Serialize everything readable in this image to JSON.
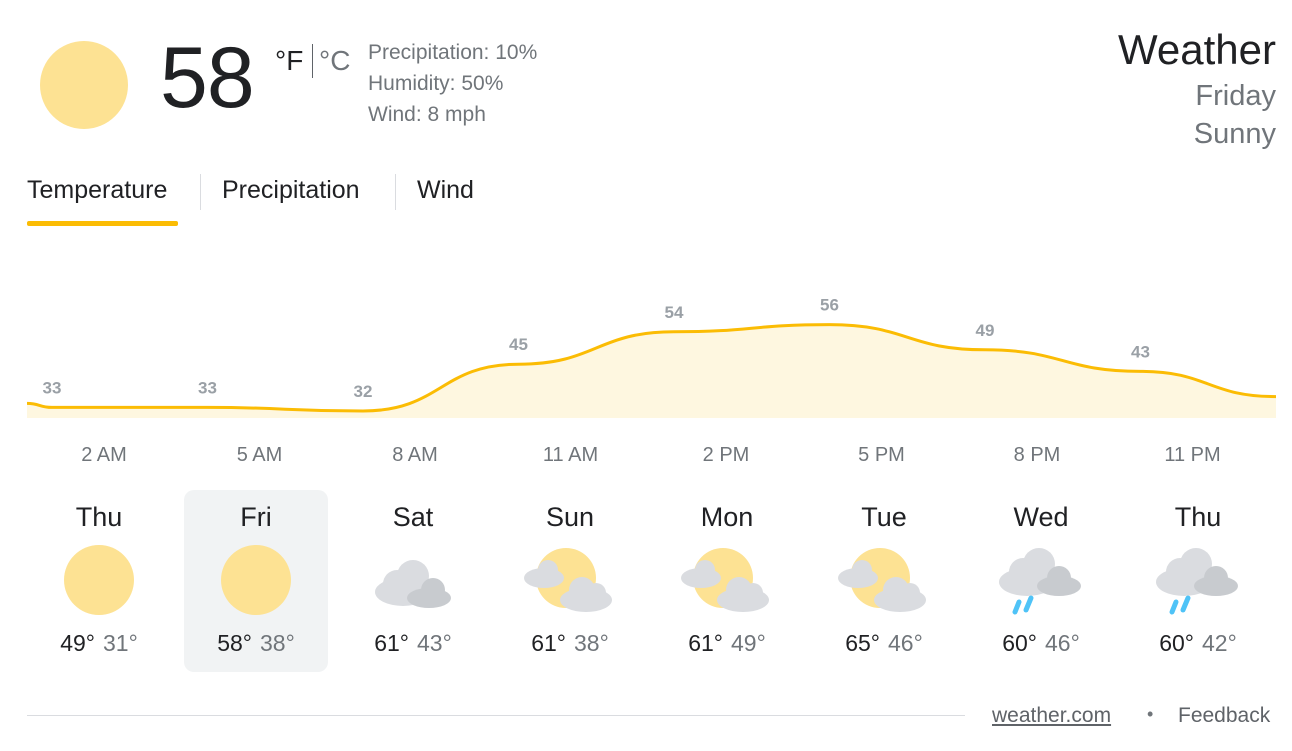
{
  "current": {
    "temperature": "58",
    "unit_f": "°F",
    "unit_c": "°C",
    "precipitation": "Precipitation: 10%",
    "humidity": "Humidity: 50%",
    "wind": "Wind: 8 mph",
    "icon": "sun-icon"
  },
  "header": {
    "title": "Weather",
    "day": "Friday",
    "condition": "Sunny"
  },
  "tabs": [
    "Temperature",
    "Precipitation",
    "Wind"
  ],
  "selected_tab": "Temperature",
  "chart_data": {
    "type": "area",
    "x": [
      "2 AM",
      "5 AM",
      "8 AM",
      "11 AM",
      "2 PM",
      "5 PM",
      "8 PM",
      "11 PM"
    ],
    "values": [
      33,
      33,
      32,
      45,
      54,
      56,
      49,
      43
    ],
    "color": "#fbbc04",
    "fill": "#fef7e0"
  },
  "days": [
    {
      "name": "Thu",
      "icon": "sunny-icon",
      "high": "49°",
      "low": "31°"
    },
    {
      "name": "Fri",
      "icon": "sunny-icon",
      "high": "58°",
      "low": "38°",
      "selected": true
    },
    {
      "name": "Sat",
      "icon": "cloudy-icon",
      "high": "61°",
      "low": "43°"
    },
    {
      "name": "Sun",
      "icon": "partly-cloudy-icon",
      "high": "61°",
      "low": "38°"
    },
    {
      "name": "Mon",
      "icon": "partly-cloudy-icon",
      "high": "61°",
      "low": "49°"
    },
    {
      "name": "Tue",
      "icon": "partly-cloudy-icon",
      "high": "65°",
      "low": "46°"
    },
    {
      "name": "Wed",
      "icon": "showers-icon",
      "high": "60°",
      "low": "46°"
    },
    {
      "name": "Thu",
      "icon": "showers-icon",
      "high": "60°",
      "low": "42°"
    }
  ],
  "footer": {
    "source": "weather.com",
    "separator": "•",
    "feedback": "Feedback"
  },
  "colors": {
    "sun": "#fde293",
    "accent": "#fbbc04",
    "cloud": "#dadce0",
    "rain": "#4fc3f7"
  }
}
